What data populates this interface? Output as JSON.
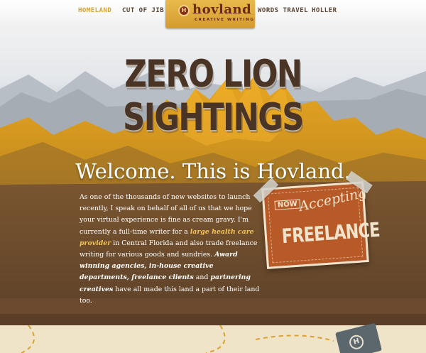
{
  "nav": {
    "items": [
      {
        "label": "HOMELAND",
        "active": true
      },
      {
        "label": "CUT OF JIB",
        "active": false
      },
      {
        "label": "WORDS TRAVEL",
        "active": false
      },
      {
        "label": "HOLLER",
        "active": false
      }
    ]
  },
  "logo": {
    "badge": "H",
    "word": "hovland",
    "sub": "CREATIVE WRITING"
  },
  "hero": {
    "headline": "ZERO LION SIGHTINGS",
    "welcome": "Welcome. This is Hovland.",
    "intro": {
      "p1": "As one of the thousands of new websites to launch recently, I speak on behalf of all of us that we hope your virtual experience is fine as cream gravy. I'm currently a full-time writer for a ",
      "link1": "large health care provider",
      "p2": " in Central Florida and also trade freelance writing for various goods and sundries. ",
      "em1": "Award winning agencies, in-house creative departments, freelance clients",
      "p3": " and ",
      "em2": "partnering creatives",
      "p4": " have all made this land a part of their land too."
    }
  },
  "sign": {
    "now": "NOW",
    "accepting": "Accepting",
    "freelance": "FREELANCE"
  },
  "footer_badge": "H",
  "colors": {
    "accent": "#d9a232",
    "brown": "#4a3426",
    "sign": "#b85a27"
  }
}
